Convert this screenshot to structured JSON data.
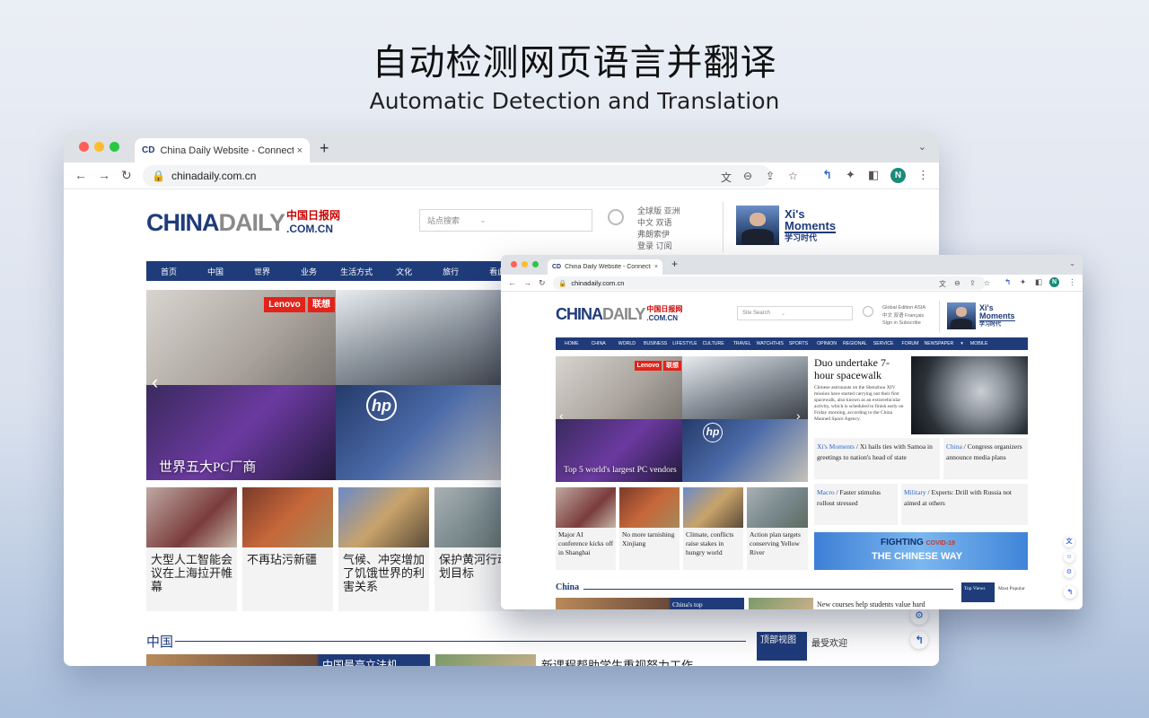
{
  "hero": {
    "title_zh": "自动检测网页语言并翻译",
    "title_en": "Automatic Detection and Translation"
  },
  "colors": {
    "navy": "#1f3b7a",
    "translate_accent": "#2f66d0",
    "chrome_tabbar": "#dee1e6"
  },
  "icons": {
    "translate": "↰",
    "extensions": "✦",
    "sidepanel": "◧",
    "menu": "⋮",
    "star": "☆",
    "share": "⇪",
    "zoom": "⊖",
    "page_translate": "文"
  },
  "browser": {
    "tab_title": "China Daily Website - Connecti",
    "tab_title_small": "China Daily Website - Connecti",
    "favicon": "CD",
    "url": "chinadaily.com.cn",
    "avatar": "N",
    "newtab": "+",
    "close": "×",
    "back": "←",
    "forward": "→",
    "reload": "↻"
  },
  "site_zh": {
    "logo_china": "CHINA",
    "logo_daily": "DAILY",
    "logo_cn": "中国日报网",
    "logo_dom": ".COM.CN",
    "search_placeholder": "站点搜索",
    "editions": [
      "全球版 亚洲",
      "中文 双语",
      "弗朗索伊",
      "登录 订阅"
    ],
    "xi_en_1": "Xi's",
    "xi_en_2": "Moments",
    "xi_zh": "学习时代",
    "nav": [
      "首页",
      "中国",
      "世界",
      "业务",
      "生活方式",
      "文化",
      "旅行",
      "看此"
    ],
    "slide_caption": "世界五大PC厂商",
    "lenovo_label": "Lenovo",
    "lenovo_zh": "联想",
    "hp_label": "hp",
    "cards": [
      "大型人工智能会议在上海拉开帷幕",
      "不再玷污新疆",
      "气候、冲突增加了饥饿世界的利害关系",
      "保护黄河行动计划目标"
    ],
    "section": "中国",
    "top_views": "顶部视图",
    "most_popular": "最受欢迎",
    "bottom_1": "中国最高立法机",
    "bottom_2": "新课程帮助学生重视努力工作"
  },
  "site_en": {
    "search_placeholder": "Site Search",
    "editions": [
      "Global Edition ASIA",
      "中文 双语 Français",
      "Sign in Subscribe"
    ],
    "nav": [
      "HOME",
      "CHINA",
      "WORLD",
      "BUSINESS",
      "LIFESTYLE",
      "CULTURE",
      "TRAVEL",
      "WATCHTHIS",
      "SPORTS",
      "OPINION",
      "REGIONAL",
      "SERVICE",
      "FORUM",
      "NEWSPAPER",
      "▾",
      "MOBILE"
    ],
    "slide_caption": "Top 5 world's largest PC vendors",
    "headline": "Duo undertake 7-hour spacewalk",
    "summary": "Chinese astronauts on the Shenzhou XIV mission have started carrying out their first spacewalk, also known as an extravehicular activity, which is scheduled to finish early on Friday morning, according to the China Manned Space Agency.",
    "stories": [
      {
        "kicker": "Xi's Moments",
        "sep": " / ",
        "text": "Xi hails ties with Samoa in greetings to nation's head of state"
      },
      {
        "kicker": "China",
        "sep": " / ",
        "text": "Congress organizers announce media plans"
      },
      {
        "kicker": "Macro",
        "sep": " / ",
        "text": "Faster stimulus rollout stressed"
      },
      {
        "kicker": "Military",
        "sep": " / ",
        "text": "Experts: Drill with Russia not aimed at others"
      }
    ],
    "cards": [
      "Major AI conference kicks off in Shanghai",
      "No more tarnishing Xinjiang",
      "Climate, conflicts raise stakes in hungry world",
      "Action plan targets conserving Yellow River"
    ],
    "banner_top": "FIGHTING",
    "banner_covid": "COVID-19",
    "banner_bottom": "THE CHINESE WAY",
    "section": "China",
    "bottom_1": "China's top",
    "bottom_2": "New courses help students value hard",
    "top_views": "Top Views",
    "most_popular": "Most Popular"
  }
}
